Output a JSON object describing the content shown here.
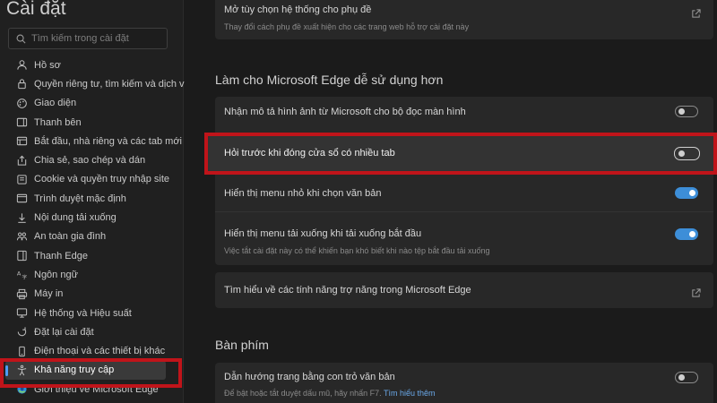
{
  "sidebar": {
    "title": "Cài đặt",
    "search_placeholder": "Tìm kiếm trong cài đặt",
    "items": [
      {
        "label": "Hồ sơ",
        "icon": "profile-icon"
      },
      {
        "label": "Quyền riêng tư, tìm kiếm và dịch vụ",
        "icon": "lock-icon"
      },
      {
        "label": "Giao diện",
        "icon": "appearance-icon"
      },
      {
        "label": "Thanh bên",
        "icon": "sidebar-icon"
      },
      {
        "label": "Bắt đầu, nhà riêng và các tab mới",
        "icon": "home-icon"
      },
      {
        "label": "Chia sẻ, sao chép và dán",
        "icon": "share-icon"
      },
      {
        "label": "Cookie và quyền truy nhập site",
        "icon": "cookie-icon"
      },
      {
        "label": "Trình duyệt mặc định",
        "icon": "browser-icon"
      },
      {
        "label": "Nội dung tải xuống",
        "icon": "download-icon"
      },
      {
        "label": "An toàn gia đình",
        "icon": "family-icon"
      },
      {
        "label": "Thanh Edge",
        "icon": "edge-bar-icon"
      },
      {
        "label": "Ngôn ngữ",
        "icon": "language-icon"
      },
      {
        "label": "Máy in",
        "icon": "printer-icon"
      },
      {
        "label": "Hệ thống và Hiệu suất",
        "icon": "system-icon"
      },
      {
        "label": "Đặt lại cài đặt",
        "icon": "reset-icon"
      },
      {
        "label": "Điện thoại và các thiết bị khác",
        "icon": "phone-icon"
      },
      {
        "label": "Khả năng truy cập",
        "icon": "accessibility-icon",
        "active": true
      },
      {
        "label": "Giới thiệu về Microsoft Edge",
        "icon": "edge-icon"
      }
    ]
  },
  "main": {
    "top_row": {
      "title": "Mở tùy chọn hệ thống cho phụ đề",
      "desc": "Thay đổi cách phụ đề xuất hiện cho các trang web hỗ trợ cài đặt này"
    },
    "section1_heading": "Làm cho Microsoft Edge dễ sử dụng hơn",
    "rows": [
      {
        "title": "Nhận mô tả hình ảnh từ Microsoft cho bộ đọc màn hình",
        "toggle": "off"
      },
      {
        "title": "Hỏi trước khi đóng cửa sổ có nhiều tab",
        "toggle": "off"
      },
      {
        "title": "Hiển thị menu nhỏ khi chọn văn bản",
        "toggle": "on"
      },
      {
        "title": "Hiển thị menu tải xuống khi tải xuống bắt đầu",
        "desc": "Việc tắt cài đặt này có thể khiến bạn khó biết khi nào tệp bắt đầu tải xuống",
        "toggle": "on"
      }
    ],
    "learn_more_row": "Tìm hiểu về các tính năng trợ năng trong Microsoft Edge",
    "section2_heading": "Bàn phím",
    "keyboard_row": {
      "title": "Dẫn hướng trang bằng con trỏ văn bản",
      "desc": "Để bật hoặc tắt duyệt dấu mũ, hãy nhấn F7.",
      "link": "Tìm hiểu thêm",
      "toggle": "off"
    }
  },
  "colors": {
    "highlight": "#c0141a",
    "accent": "#3d8ed8"
  }
}
